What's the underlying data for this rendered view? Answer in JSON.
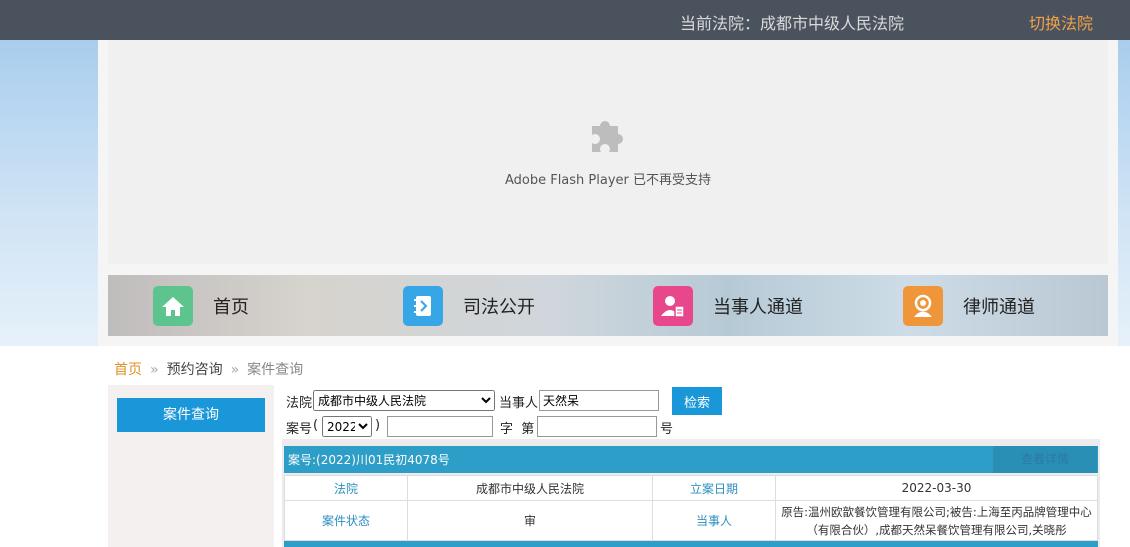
{
  "header": {
    "current_court": "当前法院：成都市中级人民法院",
    "switch_court": "切换法院"
  },
  "flash": {
    "message": "Adobe Flash Player 已不再受支持",
    "icon": "puzzle-piece-icon"
  },
  "nav": [
    {
      "label": "首页",
      "icon": "home-icon",
      "color": "#5cc48c"
    },
    {
      "label": "司法公开",
      "icon": "notebook-icon",
      "color": "#36a6e6"
    },
    {
      "label": "当事人通道",
      "icon": "person-document-icon",
      "color": "#e8478c"
    },
    {
      "label": "律师通道",
      "icon": "lawyer-icon",
      "color": "#f0963a"
    }
  ],
  "breadcrumb": {
    "home": "首页",
    "sep": "»",
    "level2": "预约咨询",
    "current": "案件查询"
  },
  "sidebar": {
    "case_query": "案件查询"
  },
  "search_form": {
    "court_label": "法院",
    "court_selected": "成都市中级人民法院",
    "party_label": "当事人",
    "party_value": "天然呆",
    "search_button": "检索",
    "case_no_label": "案号",
    "paren_open": "(",
    "paren_close": ")",
    "year_selected": "2022",
    "zi_label": "字  第",
    "hao_label": "号"
  },
  "result": {
    "case_number": "案号:(2022)川01民初4078号",
    "detail_link": "查看详情",
    "rows": [
      {
        "k1": "法院",
        "v1": "成都市中级人民法院",
        "k2": "立案日期",
        "v2": "2022-03-30"
      },
      {
        "k1": "案件状态",
        "v1": "审",
        "k2": "当事人",
        "v2": "原告:温州欧歆餐饮管理有限公司;被告:上海至丙品牌管理中心（有限合伙）,成都天然呆餐饮管理有限公司,关晓彤"
      }
    ]
  }
}
